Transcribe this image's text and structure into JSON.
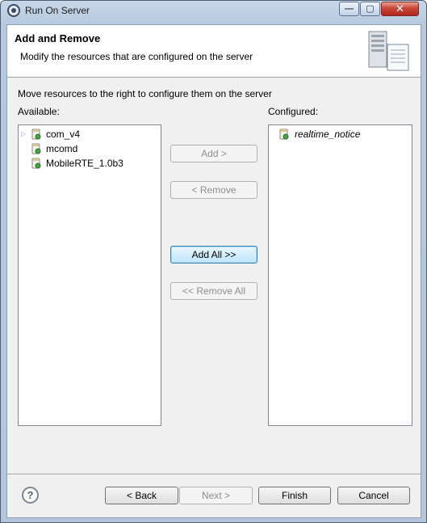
{
  "window": {
    "title": "Run On Server"
  },
  "title_buttons": {
    "minimize": "—",
    "maximize": "▢",
    "close": "✕"
  },
  "banner": {
    "title": "Add and Remove",
    "description": "Modify the resources that are configured on the server",
    "image_icon": "server-document-icon"
  },
  "instruction": "Move resources to the right to configure them on the server",
  "available": {
    "label": "Available:",
    "items": [
      {
        "label": "com_v4",
        "expandable": true,
        "icon": "project-icon"
      },
      {
        "label": "mcomd",
        "expandable": false,
        "icon": "project-icon"
      },
      {
        "label": "MobileRTE_1.0b3",
        "expandable": false,
        "icon": "project-icon"
      }
    ]
  },
  "configured": {
    "label": "Configured:",
    "items": [
      {
        "label": "realtime_notice",
        "icon": "project-icon"
      }
    ]
  },
  "transfer_buttons": {
    "add": "Add >",
    "remove": "< Remove",
    "add_all": "Add All >>",
    "remove_all": "<< Remove All"
  },
  "footer": {
    "help": "?",
    "back": "< Back",
    "next": "Next >",
    "finish": "Finish",
    "cancel": "Cancel"
  },
  "colors": {
    "accent": "#3c7fb1",
    "title_bar": "#b6c9df",
    "close": "#c9473a"
  }
}
